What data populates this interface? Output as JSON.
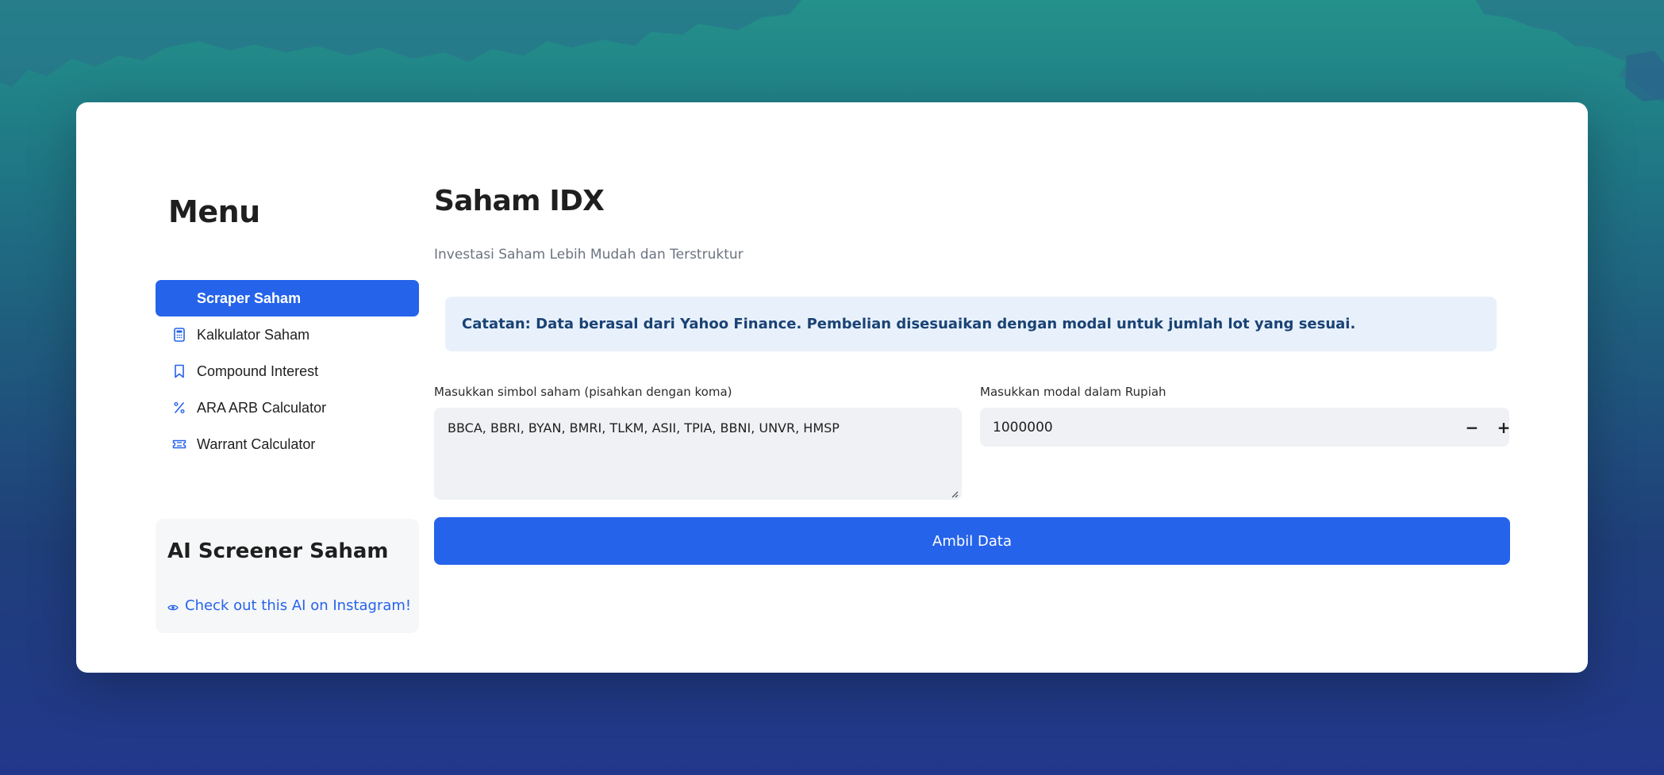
{
  "sidebar": {
    "title": "Menu",
    "items": [
      {
        "label": "Scraper Saham",
        "icon": "none",
        "active": true
      },
      {
        "label": "Kalkulator Saham",
        "icon": "calculator-icon",
        "active": false
      },
      {
        "label": "Compound Interest",
        "icon": "bookmark-icon",
        "active": false
      },
      {
        "label": "ARA ARB Calculator",
        "icon": "percent-icon",
        "active": false
      },
      {
        "label": "Warrant Calculator",
        "icon": "ticket-icon",
        "active": false
      }
    ],
    "promo": {
      "title": "AI Screener Saham",
      "link_label": "Check out this AI on Instagram!",
      "link_icon": "eye-icon"
    }
  },
  "main": {
    "title": "Saham IDX",
    "subtitle": "Investasi Saham Lebih Mudah dan Terstruktur",
    "note": "Catatan: Data berasal dari Yahoo Finance. Pembelian disesuaikan dengan modal untuk jumlah lot yang sesuai.",
    "symbols": {
      "label": "Masukkan simbol saham (pisahkan dengan koma)",
      "value": "BBCA, BBRI, BYAN, BMRI, TLKM, ASII, TPIA, BBNI, UNVR, HMSP"
    },
    "capital": {
      "label": "Masukkan modal dalam Rupiah",
      "value": "1000000",
      "minus": "−",
      "plus": "+"
    },
    "submit_label": "Ambil Data"
  },
  "colors": {
    "accent": "#2563eb",
    "info_bg": "#e8f1fb",
    "info_text": "#1a4274",
    "input_bg": "#eff1f4"
  }
}
